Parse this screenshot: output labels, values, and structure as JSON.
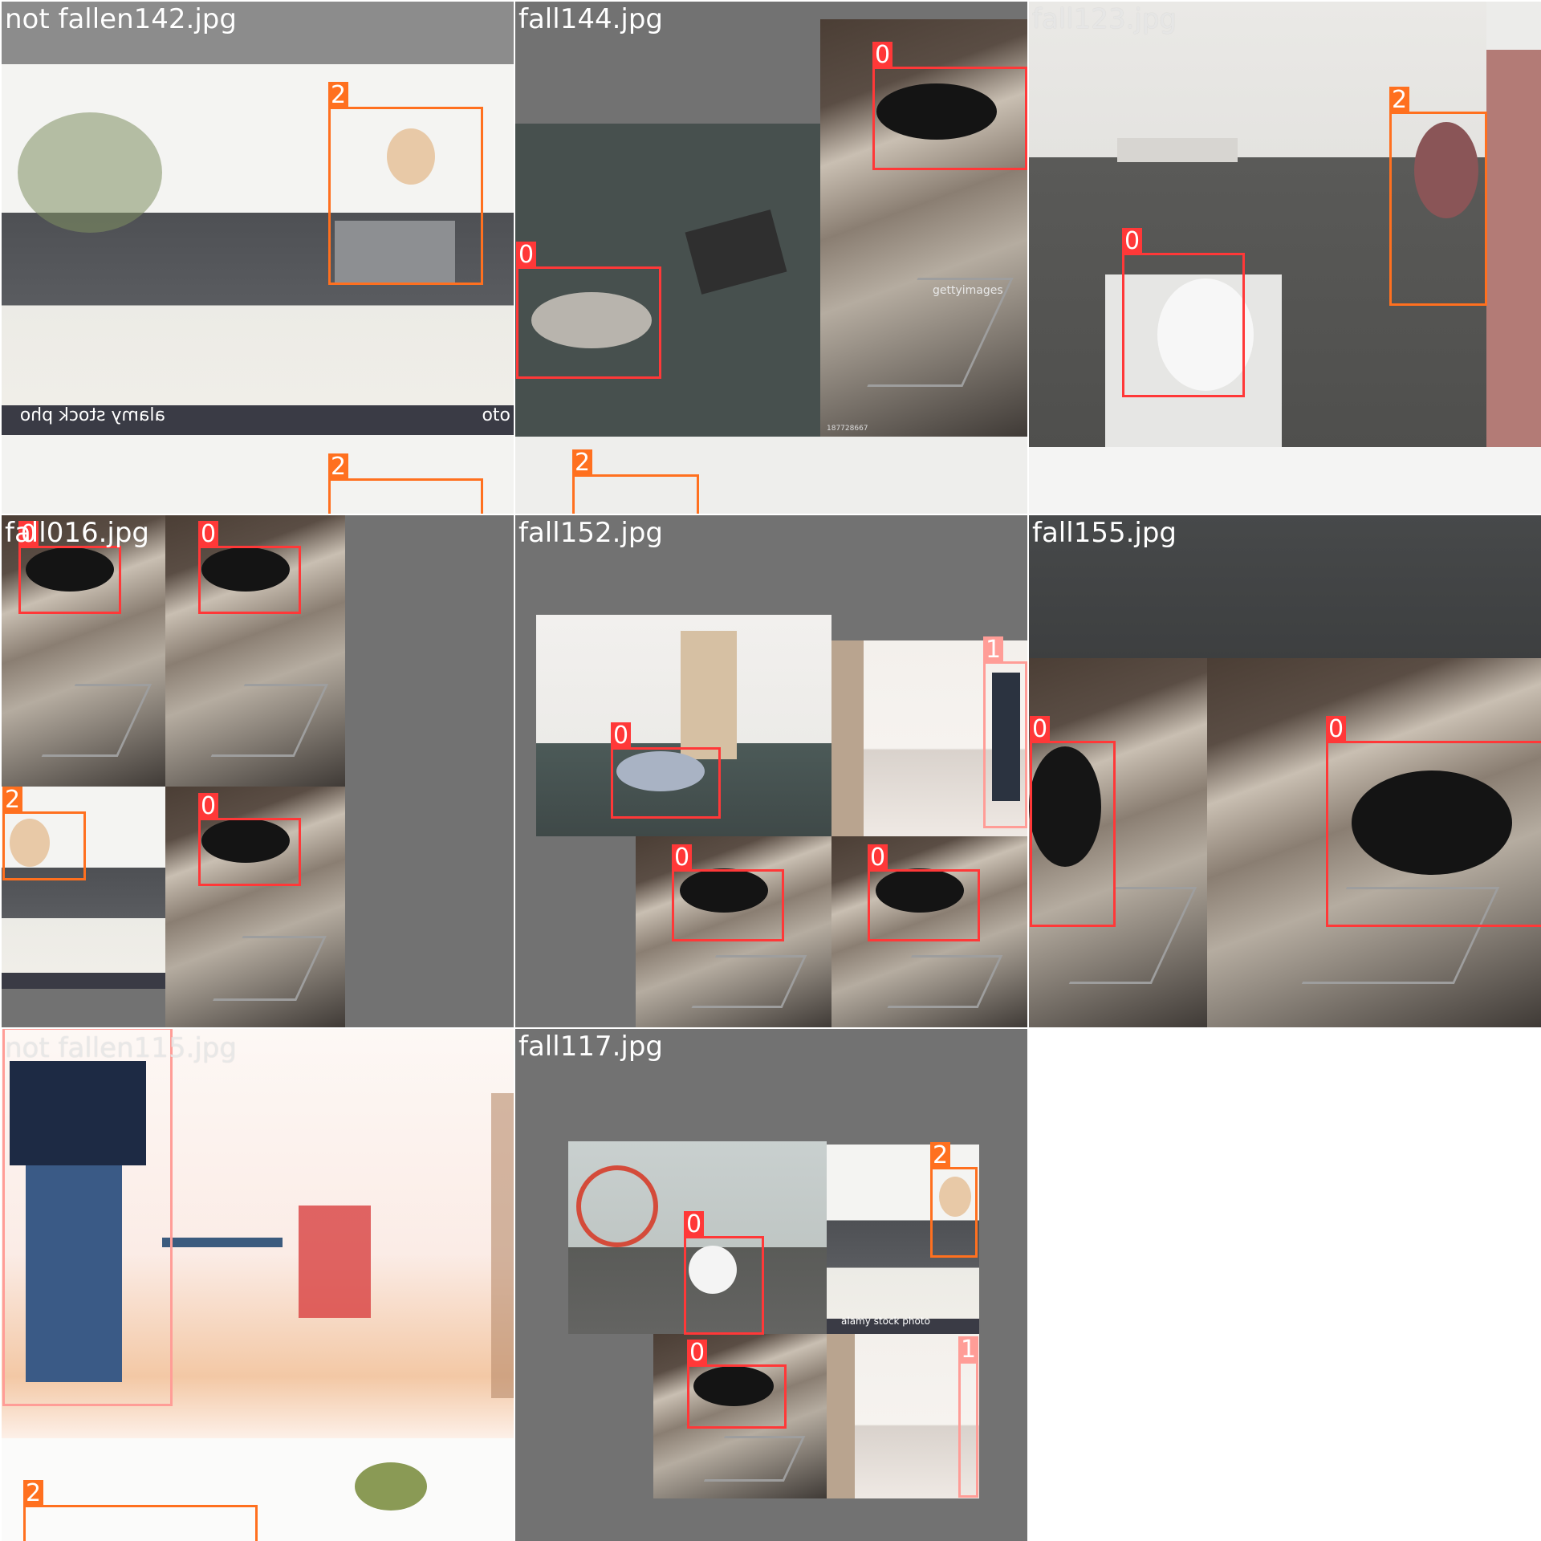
{
  "tiles": [
    {
      "filename": "not fallen142.jpg"
    },
    {
      "filename": "fall144.jpg"
    },
    {
      "filename": "fall123.jpg"
    },
    {
      "filename": "fall016.jpg"
    },
    {
      "filename": "fall152.jpg"
    },
    {
      "filename": "fall155.jpg"
    },
    {
      "filename": "not fallen115.jpg"
    },
    {
      "filename": "fall117.jpg"
    }
  ],
  "class_colors": {
    "0": "#ff3838",
    "1": "#ff9d97",
    "2": "#ff701f"
  },
  "labels": {
    "zero": "0",
    "one": "1",
    "two": "2"
  },
  "watermarks": {
    "alamy": "alamy stock photo",
    "alamy_mirrored": "alamy stock pho",
    "getty": "gettyimages",
    "getty_code": "187728667",
    "oto": "oto"
  }
}
